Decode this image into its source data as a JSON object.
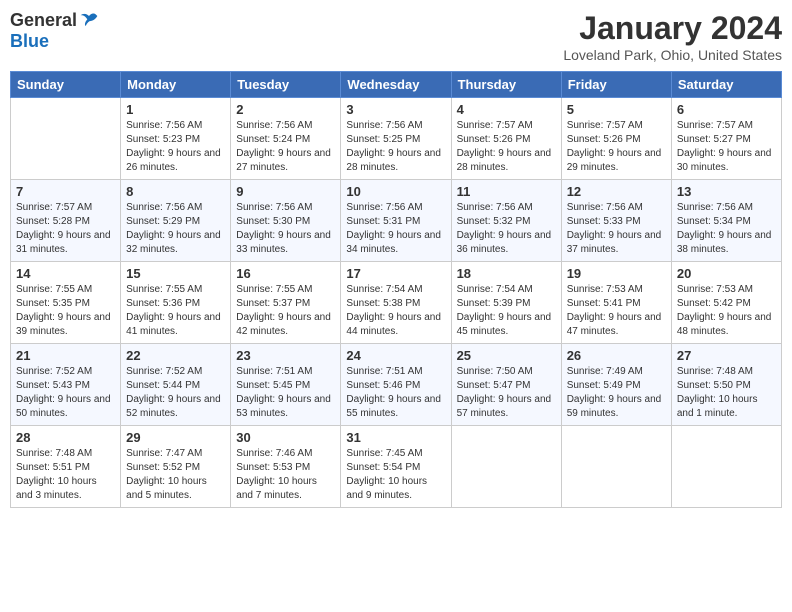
{
  "header": {
    "logo": {
      "general": "General",
      "blue": "Blue"
    },
    "title": "January 2024",
    "location": "Loveland Park, Ohio, United States"
  },
  "calendar": {
    "headers": [
      "Sunday",
      "Monday",
      "Tuesday",
      "Wednesday",
      "Thursday",
      "Friday",
      "Saturday"
    ],
    "weeks": [
      [
        {
          "day": "",
          "sunrise": "",
          "sunset": "",
          "daylight": ""
        },
        {
          "day": "1",
          "sunrise": "Sunrise: 7:56 AM",
          "sunset": "Sunset: 5:23 PM",
          "daylight": "Daylight: 9 hours and 26 minutes."
        },
        {
          "day": "2",
          "sunrise": "Sunrise: 7:56 AM",
          "sunset": "Sunset: 5:24 PM",
          "daylight": "Daylight: 9 hours and 27 minutes."
        },
        {
          "day": "3",
          "sunrise": "Sunrise: 7:56 AM",
          "sunset": "Sunset: 5:25 PM",
          "daylight": "Daylight: 9 hours and 28 minutes."
        },
        {
          "day": "4",
          "sunrise": "Sunrise: 7:57 AM",
          "sunset": "Sunset: 5:26 PM",
          "daylight": "Daylight: 9 hours and 28 minutes."
        },
        {
          "day": "5",
          "sunrise": "Sunrise: 7:57 AM",
          "sunset": "Sunset: 5:26 PM",
          "daylight": "Daylight: 9 hours and 29 minutes."
        },
        {
          "day": "6",
          "sunrise": "Sunrise: 7:57 AM",
          "sunset": "Sunset: 5:27 PM",
          "daylight": "Daylight: 9 hours and 30 minutes."
        }
      ],
      [
        {
          "day": "7",
          "sunrise": "Sunrise: 7:57 AM",
          "sunset": "Sunset: 5:28 PM",
          "daylight": "Daylight: 9 hours and 31 minutes."
        },
        {
          "day": "8",
          "sunrise": "Sunrise: 7:56 AM",
          "sunset": "Sunset: 5:29 PM",
          "daylight": "Daylight: 9 hours and 32 minutes."
        },
        {
          "day": "9",
          "sunrise": "Sunrise: 7:56 AM",
          "sunset": "Sunset: 5:30 PM",
          "daylight": "Daylight: 9 hours and 33 minutes."
        },
        {
          "day": "10",
          "sunrise": "Sunrise: 7:56 AM",
          "sunset": "Sunset: 5:31 PM",
          "daylight": "Daylight: 9 hours and 34 minutes."
        },
        {
          "day": "11",
          "sunrise": "Sunrise: 7:56 AM",
          "sunset": "Sunset: 5:32 PM",
          "daylight": "Daylight: 9 hours and 36 minutes."
        },
        {
          "day": "12",
          "sunrise": "Sunrise: 7:56 AM",
          "sunset": "Sunset: 5:33 PM",
          "daylight": "Daylight: 9 hours and 37 minutes."
        },
        {
          "day": "13",
          "sunrise": "Sunrise: 7:56 AM",
          "sunset": "Sunset: 5:34 PM",
          "daylight": "Daylight: 9 hours and 38 minutes."
        }
      ],
      [
        {
          "day": "14",
          "sunrise": "Sunrise: 7:55 AM",
          "sunset": "Sunset: 5:35 PM",
          "daylight": "Daylight: 9 hours and 39 minutes."
        },
        {
          "day": "15",
          "sunrise": "Sunrise: 7:55 AM",
          "sunset": "Sunset: 5:36 PM",
          "daylight": "Daylight: 9 hours and 41 minutes."
        },
        {
          "day": "16",
          "sunrise": "Sunrise: 7:55 AM",
          "sunset": "Sunset: 5:37 PM",
          "daylight": "Daylight: 9 hours and 42 minutes."
        },
        {
          "day": "17",
          "sunrise": "Sunrise: 7:54 AM",
          "sunset": "Sunset: 5:38 PM",
          "daylight": "Daylight: 9 hours and 44 minutes."
        },
        {
          "day": "18",
          "sunrise": "Sunrise: 7:54 AM",
          "sunset": "Sunset: 5:39 PM",
          "daylight": "Daylight: 9 hours and 45 minutes."
        },
        {
          "day": "19",
          "sunrise": "Sunrise: 7:53 AM",
          "sunset": "Sunset: 5:41 PM",
          "daylight": "Daylight: 9 hours and 47 minutes."
        },
        {
          "day": "20",
          "sunrise": "Sunrise: 7:53 AM",
          "sunset": "Sunset: 5:42 PM",
          "daylight": "Daylight: 9 hours and 48 minutes."
        }
      ],
      [
        {
          "day": "21",
          "sunrise": "Sunrise: 7:52 AM",
          "sunset": "Sunset: 5:43 PM",
          "daylight": "Daylight: 9 hours and 50 minutes."
        },
        {
          "day": "22",
          "sunrise": "Sunrise: 7:52 AM",
          "sunset": "Sunset: 5:44 PM",
          "daylight": "Daylight: 9 hours and 52 minutes."
        },
        {
          "day": "23",
          "sunrise": "Sunrise: 7:51 AM",
          "sunset": "Sunset: 5:45 PM",
          "daylight": "Daylight: 9 hours and 53 minutes."
        },
        {
          "day": "24",
          "sunrise": "Sunrise: 7:51 AM",
          "sunset": "Sunset: 5:46 PM",
          "daylight": "Daylight: 9 hours and 55 minutes."
        },
        {
          "day": "25",
          "sunrise": "Sunrise: 7:50 AM",
          "sunset": "Sunset: 5:47 PM",
          "daylight": "Daylight: 9 hours and 57 minutes."
        },
        {
          "day": "26",
          "sunrise": "Sunrise: 7:49 AM",
          "sunset": "Sunset: 5:49 PM",
          "daylight": "Daylight: 9 hours and 59 minutes."
        },
        {
          "day": "27",
          "sunrise": "Sunrise: 7:48 AM",
          "sunset": "Sunset: 5:50 PM",
          "daylight": "Daylight: 10 hours and 1 minute."
        }
      ],
      [
        {
          "day": "28",
          "sunrise": "Sunrise: 7:48 AM",
          "sunset": "Sunset: 5:51 PM",
          "daylight": "Daylight: 10 hours and 3 minutes."
        },
        {
          "day": "29",
          "sunrise": "Sunrise: 7:47 AM",
          "sunset": "Sunset: 5:52 PM",
          "daylight": "Daylight: 10 hours and 5 minutes."
        },
        {
          "day": "30",
          "sunrise": "Sunrise: 7:46 AM",
          "sunset": "Sunset: 5:53 PM",
          "daylight": "Daylight: 10 hours and 7 minutes."
        },
        {
          "day": "31",
          "sunrise": "Sunrise: 7:45 AM",
          "sunset": "Sunset: 5:54 PM",
          "daylight": "Daylight: 10 hours and 9 minutes."
        },
        {
          "day": "",
          "sunrise": "",
          "sunset": "",
          "daylight": ""
        },
        {
          "day": "",
          "sunrise": "",
          "sunset": "",
          "daylight": ""
        },
        {
          "day": "",
          "sunrise": "",
          "sunset": "",
          "daylight": ""
        }
      ]
    ]
  }
}
